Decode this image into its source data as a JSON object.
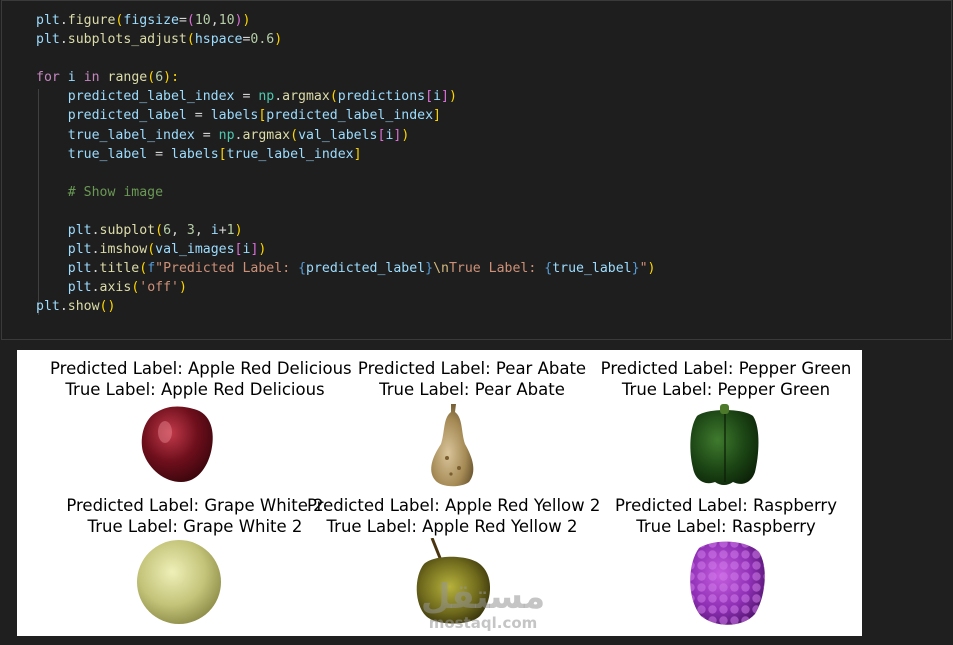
{
  "code_lines": [
    [
      {
        "t": "plt",
        "c": "#9cdcfe"
      },
      {
        "t": ".",
        "c": "#d4d4d4"
      },
      {
        "t": "figure",
        "c": "#dcdcaa"
      },
      {
        "t": "(",
        "c": "#ffd700"
      },
      {
        "t": "figsize",
        "c": "#9cdcfe"
      },
      {
        "t": "=",
        "c": "#d4d4d4"
      },
      {
        "t": "(",
        "c": "#da70d6"
      },
      {
        "t": "10",
        "c": "#b5cea8"
      },
      {
        "t": ",",
        "c": "#d4d4d4"
      },
      {
        "t": "10",
        "c": "#b5cea8"
      },
      {
        "t": ")",
        "c": "#da70d6"
      },
      {
        "t": ")",
        "c": "#ffd700"
      }
    ],
    [
      {
        "t": "plt",
        "c": "#9cdcfe"
      },
      {
        "t": ".",
        "c": "#d4d4d4"
      },
      {
        "t": "subplots_adjust",
        "c": "#dcdcaa"
      },
      {
        "t": "(",
        "c": "#ffd700"
      },
      {
        "t": "hspace",
        "c": "#9cdcfe"
      },
      {
        "t": "=",
        "c": "#d4d4d4"
      },
      {
        "t": "0.6",
        "c": "#b5cea8"
      },
      {
        "t": ")",
        "c": "#ffd700"
      }
    ],
    [],
    [
      {
        "t": "for",
        "c": "#c586c0"
      },
      {
        "t": " ",
        "c": "#d4d4d4"
      },
      {
        "t": "i",
        "c": "#9cdcfe"
      },
      {
        "t": " ",
        "c": "#d4d4d4"
      },
      {
        "t": "in",
        "c": "#c586c0"
      },
      {
        "t": " ",
        "c": "#d4d4d4"
      },
      {
        "t": "range",
        "c": "#dcdcaa"
      },
      {
        "t": "(",
        "c": "#ffd700"
      },
      {
        "t": "6",
        "c": "#b5cea8"
      },
      {
        "t": "):",
        "c": "#ffd700"
      }
    ],
    [
      {
        "t": "    ",
        "c": "#d4d4d4"
      },
      {
        "t": "predicted_label_index",
        "c": "#9cdcfe"
      },
      {
        "t": " = ",
        "c": "#d4d4d4"
      },
      {
        "t": "np",
        "c": "#4ec9b0"
      },
      {
        "t": ".",
        "c": "#d4d4d4"
      },
      {
        "t": "argmax",
        "c": "#dcdcaa"
      },
      {
        "t": "(",
        "c": "#ffd700"
      },
      {
        "t": "predictions",
        "c": "#9cdcfe"
      },
      {
        "t": "[",
        "c": "#da70d6"
      },
      {
        "t": "i",
        "c": "#9cdcfe"
      },
      {
        "t": "]",
        "c": "#da70d6"
      },
      {
        "t": ")",
        "c": "#ffd700"
      }
    ],
    [
      {
        "t": "    ",
        "c": "#d4d4d4"
      },
      {
        "t": "predicted_label",
        "c": "#9cdcfe"
      },
      {
        "t": " = ",
        "c": "#d4d4d4"
      },
      {
        "t": "labels",
        "c": "#9cdcfe"
      },
      {
        "t": "[",
        "c": "#ffd700"
      },
      {
        "t": "predicted_label_index",
        "c": "#9cdcfe"
      },
      {
        "t": "]",
        "c": "#ffd700"
      }
    ],
    [
      {
        "t": "    ",
        "c": "#d4d4d4"
      },
      {
        "t": "true_label_index",
        "c": "#9cdcfe"
      },
      {
        "t": " = ",
        "c": "#d4d4d4"
      },
      {
        "t": "np",
        "c": "#4ec9b0"
      },
      {
        "t": ".",
        "c": "#d4d4d4"
      },
      {
        "t": "argmax",
        "c": "#dcdcaa"
      },
      {
        "t": "(",
        "c": "#ffd700"
      },
      {
        "t": "val_labels",
        "c": "#9cdcfe"
      },
      {
        "t": "[",
        "c": "#da70d6"
      },
      {
        "t": "i",
        "c": "#9cdcfe"
      },
      {
        "t": "]",
        "c": "#da70d6"
      },
      {
        "t": ")",
        "c": "#ffd700"
      }
    ],
    [
      {
        "t": "    ",
        "c": "#d4d4d4"
      },
      {
        "t": "true_label",
        "c": "#9cdcfe"
      },
      {
        "t": " = ",
        "c": "#d4d4d4"
      },
      {
        "t": "labels",
        "c": "#9cdcfe"
      },
      {
        "t": "[",
        "c": "#ffd700"
      },
      {
        "t": "true_label_index",
        "c": "#9cdcfe"
      },
      {
        "t": "]",
        "c": "#ffd700"
      }
    ],
    [],
    [
      {
        "t": "    ",
        "c": "#d4d4d4"
      },
      {
        "t": "# Show image",
        "c": "#6a9955"
      }
    ],
    [],
    [
      {
        "t": "    ",
        "c": "#d4d4d4"
      },
      {
        "t": "plt",
        "c": "#9cdcfe"
      },
      {
        "t": ".",
        "c": "#d4d4d4"
      },
      {
        "t": "subplot",
        "c": "#dcdcaa"
      },
      {
        "t": "(",
        "c": "#ffd700"
      },
      {
        "t": "6",
        "c": "#b5cea8"
      },
      {
        "t": ", ",
        "c": "#d4d4d4"
      },
      {
        "t": "3",
        "c": "#b5cea8"
      },
      {
        "t": ", ",
        "c": "#d4d4d4"
      },
      {
        "t": "i",
        "c": "#9cdcfe"
      },
      {
        "t": "+",
        "c": "#d4d4d4"
      },
      {
        "t": "1",
        "c": "#b5cea8"
      },
      {
        "t": ")",
        "c": "#ffd700"
      }
    ],
    [
      {
        "t": "    ",
        "c": "#d4d4d4"
      },
      {
        "t": "plt",
        "c": "#9cdcfe"
      },
      {
        "t": ".",
        "c": "#d4d4d4"
      },
      {
        "t": "imshow",
        "c": "#dcdcaa"
      },
      {
        "t": "(",
        "c": "#ffd700"
      },
      {
        "t": "val_images",
        "c": "#9cdcfe"
      },
      {
        "t": "[",
        "c": "#da70d6"
      },
      {
        "t": "i",
        "c": "#9cdcfe"
      },
      {
        "t": "]",
        "c": "#da70d6"
      },
      {
        "t": ")",
        "c": "#ffd700"
      }
    ],
    [
      {
        "t": "    ",
        "c": "#d4d4d4"
      },
      {
        "t": "plt",
        "c": "#9cdcfe"
      },
      {
        "t": ".",
        "c": "#d4d4d4"
      },
      {
        "t": "title",
        "c": "#dcdcaa"
      },
      {
        "t": "(",
        "c": "#ffd700"
      },
      {
        "t": "f",
        "c": "#569cd6"
      },
      {
        "t": "\"Predicted Label: ",
        "c": "#ce9178"
      },
      {
        "t": "{",
        "c": "#569cd6"
      },
      {
        "t": "predicted_label",
        "c": "#9cdcfe"
      },
      {
        "t": "}",
        "c": "#569cd6"
      },
      {
        "t": "\\n",
        "c": "#d7ba7d"
      },
      {
        "t": "True Label: ",
        "c": "#ce9178"
      },
      {
        "t": "{",
        "c": "#569cd6"
      },
      {
        "t": "true_label",
        "c": "#9cdcfe"
      },
      {
        "t": "}",
        "c": "#569cd6"
      },
      {
        "t": "\"",
        "c": "#ce9178"
      },
      {
        "t": ")",
        "c": "#ffd700"
      }
    ],
    [
      {
        "t": "    ",
        "c": "#d4d4d4"
      },
      {
        "t": "plt",
        "c": "#9cdcfe"
      },
      {
        "t": ".",
        "c": "#d4d4d4"
      },
      {
        "t": "axis",
        "c": "#dcdcaa"
      },
      {
        "t": "(",
        "c": "#ffd700"
      },
      {
        "t": "'off'",
        "c": "#ce9178"
      },
      {
        "t": ")",
        "c": "#ffd700"
      }
    ],
    [
      {
        "t": "plt",
        "c": "#9cdcfe"
      },
      {
        "t": ".",
        "c": "#d4d4d4"
      },
      {
        "t": "show",
        "c": "#dcdcaa"
      },
      {
        "t": "()",
        "c": "#ffd700"
      }
    ]
  ],
  "subplots": [
    {
      "predicted": "Predicted Label: Apple Red Delicious",
      "true": "True Label: Apple Red Delicious",
      "fruit": "apple-red"
    },
    {
      "predicted": "Predicted Label: Pear Abate",
      "true": "True Label: Pear Abate",
      "fruit": "pear"
    },
    {
      "predicted": "Predicted Label: Pepper Green",
      "true": "True Label: Pepper Green",
      "fruit": "pepper"
    },
    {
      "predicted": "Predicted Label: Grape White 2",
      "true": "True Label: Grape White 2",
      "fruit": "grape"
    },
    {
      "predicted": "Predicted Label: Apple Red Yellow 2",
      "true": "True Label: Apple Red Yellow 2",
      "fruit": "apple-yellow"
    },
    {
      "predicted": "Predicted Label: Raspberry",
      "true": "True Label: Raspberry",
      "fruit": "raspberry"
    }
  ],
  "watermark": {
    "arabic": "مستقل",
    "latin": "mostaql.com"
  }
}
